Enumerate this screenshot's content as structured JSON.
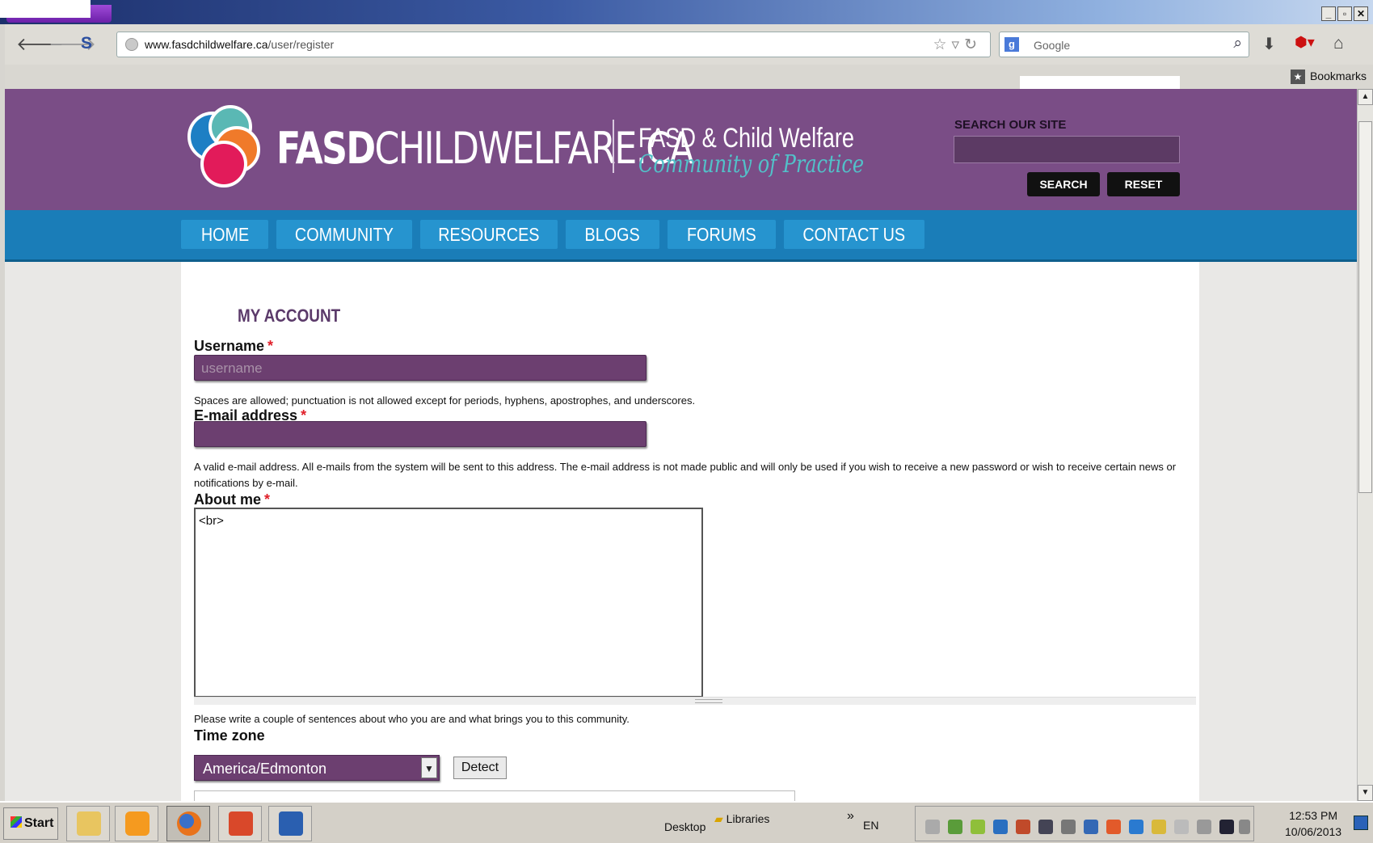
{
  "browser": {
    "url_host": "www.fasdchildwelfare.ca",
    "url_path": "/user/register",
    "search_engine": "Google",
    "bookmarks_label": "Bookmarks"
  },
  "site": {
    "name_bold": "FASD",
    "name_rest": "CHILDWELFARE.CA",
    "tagline_1": "FASD & Child Welfare",
    "tagline_2": "Community of Practice",
    "search_label": "SEARCH OUR SITE",
    "search_button": "SEARCH",
    "reset_button": "RESET",
    "colors": {
      "header": "#7a4d86",
      "menu": "#1a7db8",
      "accent_teal": "#52c1c9"
    }
  },
  "menu": [
    "HOME",
    "COMMUNITY",
    "RESOURCES",
    "BLOGS",
    "FORUMS",
    "CONTACT US"
  ],
  "form": {
    "page_title": "MY ACCOUNT",
    "username_label": "Username",
    "username_placeholder": "username",
    "username_help": "Spaces are allowed; punctuation is not allowed except for periods, hyphens, apostrophes, and underscores.",
    "email_label": "E-mail address",
    "email_help": "A valid e-mail address. All e-mails from the system will be sent to this address. The e-mail address is not made public and will only be used if you wish to receive a new password or wish to receive certain news or notifications by e-mail.",
    "about_label": "About me",
    "about_value": "<br>",
    "about_help": "Please write a couple of sentences about who you are and what brings you to this community.",
    "timezone_label": "Time zone",
    "timezone_value": "America/Edmonton",
    "detect_button": "Detect",
    "required_mark": "*"
  },
  "taskbar": {
    "start_label": "Start",
    "desktop_label": "Desktop",
    "libraries_label": "Libraries",
    "chevron": "»",
    "language": "EN",
    "time": "12:53 PM",
    "date": "10/06/2013"
  }
}
